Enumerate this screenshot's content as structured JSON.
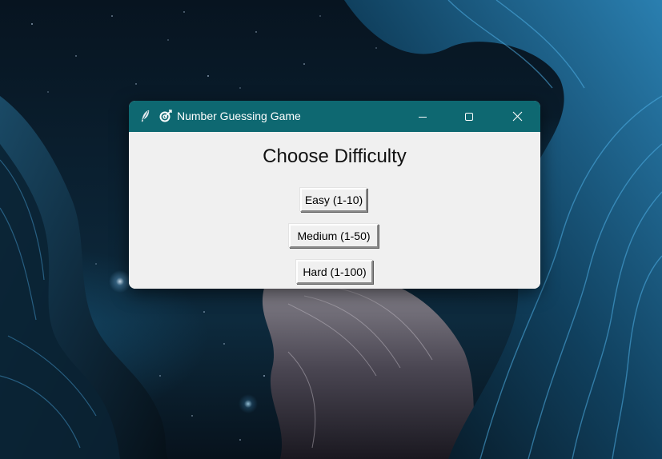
{
  "window": {
    "title": "Number Guessing Game",
    "titlebar_color": "#0e6871",
    "app_icon": "feather-icon",
    "title_icon": "target-icon",
    "controls": [
      "minimize-icon",
      "maximize-icon",
      "close-icon"
    ]
  },
  "main": {
    "heading": "Choose Difficulty",
    "buttons": [
      {
        "label": "Easy (1-10)"
      },
      {
        "label": "Medium (1-50)"
      },
      {
        "label": "Hard (1-100)"
      }
    ]
  },
  "colors": {
    "client_background": "#f0f0f0",
    "titlebar": "#0e6871"
  }
}
